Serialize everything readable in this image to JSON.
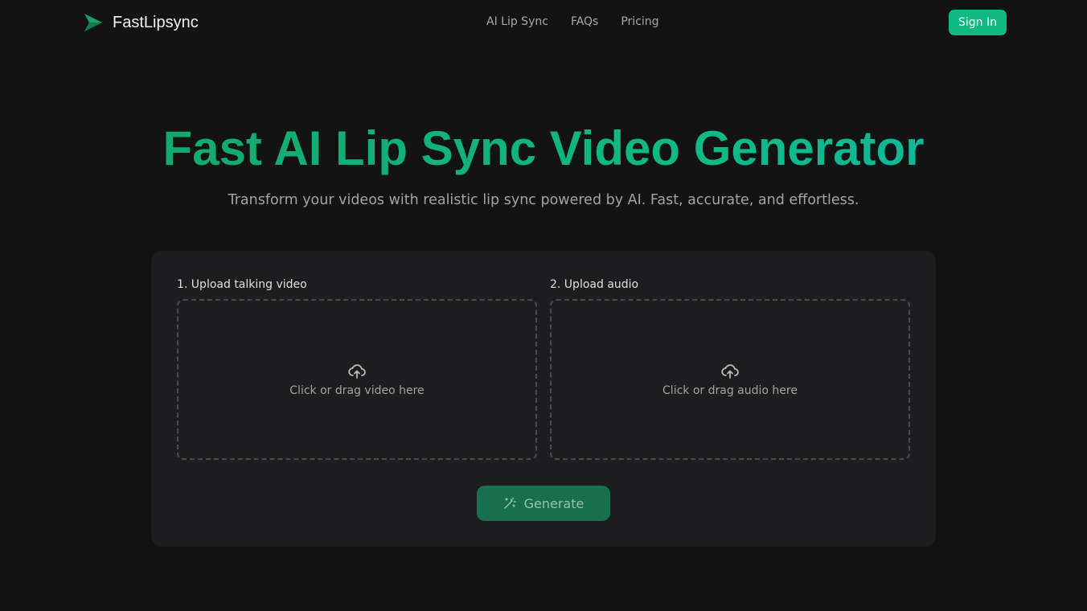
{
  "brand": {
    "name": "FastLipsync",
    "accent": "#10b981"
  },
  "nav": {
    "links": [
      "AI Lip Sync",
      "FAQs",
      "Pricing"
    ],
    "signin": "Sign In"
  },
  "hero": {
    "title": "Fast AI Lip Sync Video Generator",
    "subtitle": "Transform your videos with realistic lip sync powered by AI. Fast, accurate, and effortless."
  },
  "upload": {
    "video_label": "1. Upload talking video",
    "video_hint": "Click or drag video here",
    "audio_label": "2. Upload audio",
    "audio_hint": "Click or drag audio here",
    "generate": "Generate"
  }
}
